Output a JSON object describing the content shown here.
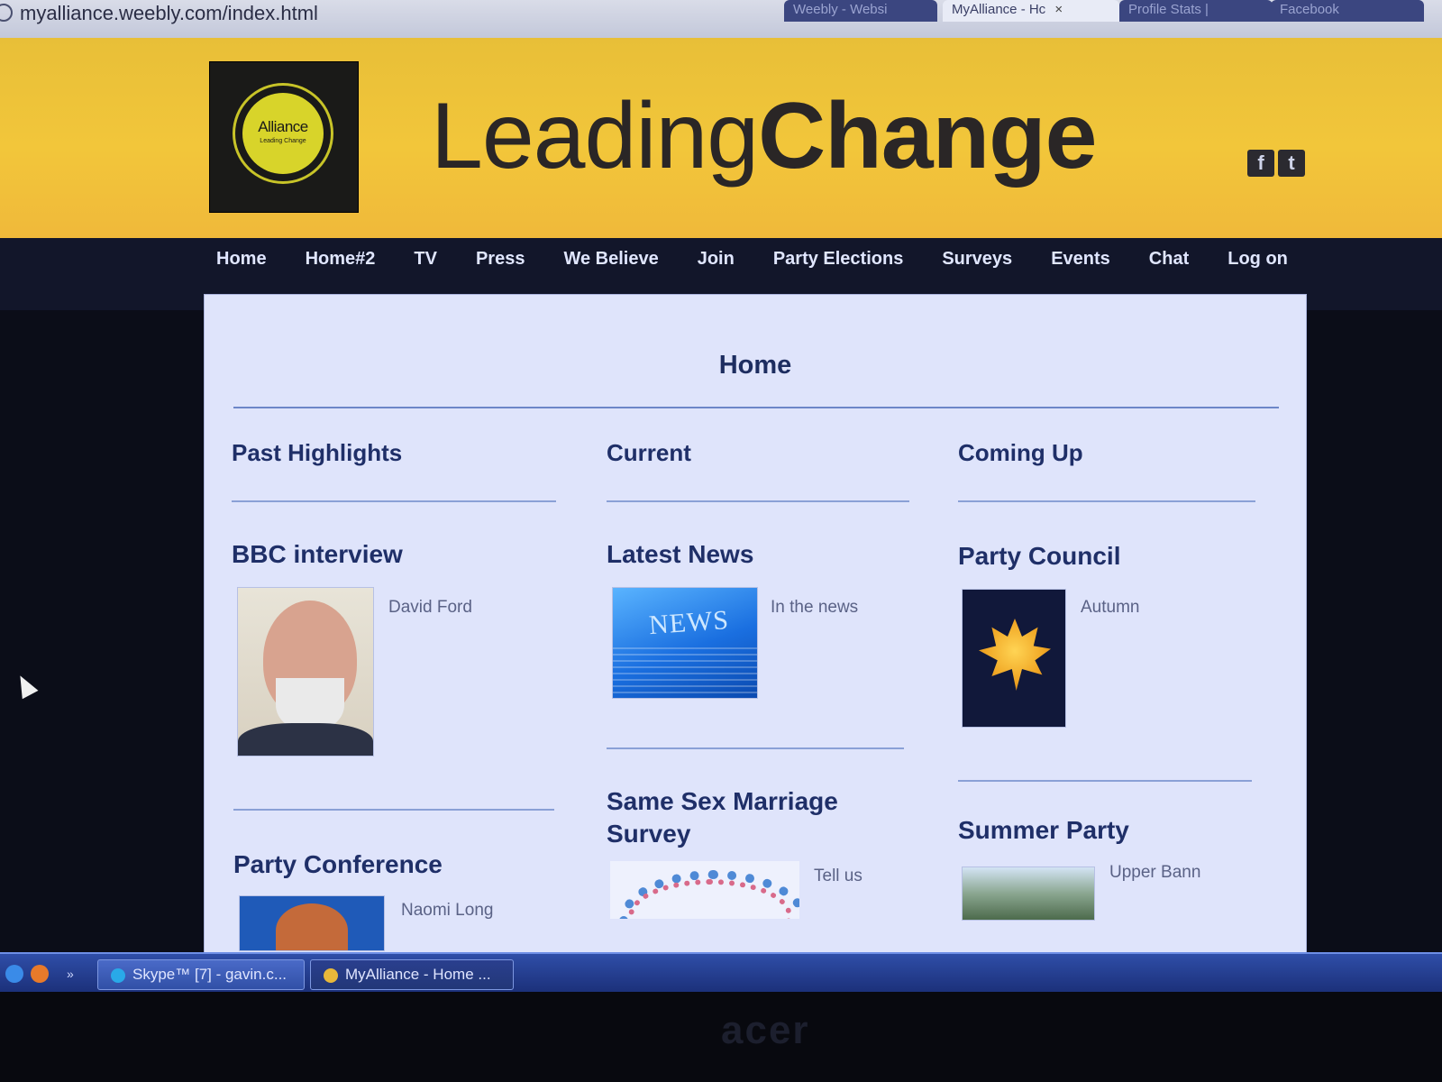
{
  "browser": {
    "url": "myalliance.weebly.com/index.html",
    "tabs": [
      {
        "label": "Weebly - Websi"
      },
      {
        "label": "MyAlliance - Hc",
        "active": true
      },
      {
        "label": "Profile Stats |"
      },
      {
        "label": "Facebook"
      }
    ]
  },
  "header": {
    "logo_text": "Alliance",
    "logo_subtext": "Leading Change",
    "title_light": "Leading",
    "title_bold": "Change",
    "social": [
      "f",
      "t"
    ]
  },
  "nav": {
    "items": [
      "Home",
      "Home#2",
      "TV",
      "Press",
      "We Believe",
      "Join",
      "Party Elections",
      "Surveys",
      "Events",
      "Chat",
      "Log on"
    ]
  },
  "page": {
    "heading": "Home",
    "columns": [
      {
        "heading": "Past Highlights",
        "entries": [
          {
            "title": "BBC interview",
            "caption": "David Ford",
            "thumb": "portrait-photo"
          },
          {
            "title": "Party Conference",
            "caption": "Naomi Long",
            "thumb": "portrait-photo"
          }
        ]
      },
      {
        "heading": "Current",
        "entries": [
          {
            "title": "Latest News",
            "caption": "In the news",
            "thumb": "news-graphic"
          },
          {
            "title_line1": "Same Sex Marriage",
            "title_line2": "Survey",
            "caption": "Tell us",
            "thumb": "people-circle-graphic"
          }
        ]
      },
      {
        "heading": "Coming Up",
        "entries": [
          {
            "title": "Party Council",
            "caption": "Autumn",
            "thumb": "maple-leaf-photo"
          },
          {
            "title": "Summer Party",
            "caption": "Upper Bann",
            "thumb": "landscape-photo"
          }
        ]
      }
    ]
  },
  "taskbar": {
    "buttons": [
      {
        "label": "Skype™ [7] - gavin.c..."
      },
      {
        "label": "MyAlliance - Home ...",
        "active": true
      }
    ]
  },
  "monitor": {
    "brand": "acer"
  },
  "colors": {
    "header_yellow": "#f2c63a",
    "nav_bg": "#12162a",
    "heading_blue": "#1f2f68",
    "panel_bg": "#dfe4fb"
  }
}
